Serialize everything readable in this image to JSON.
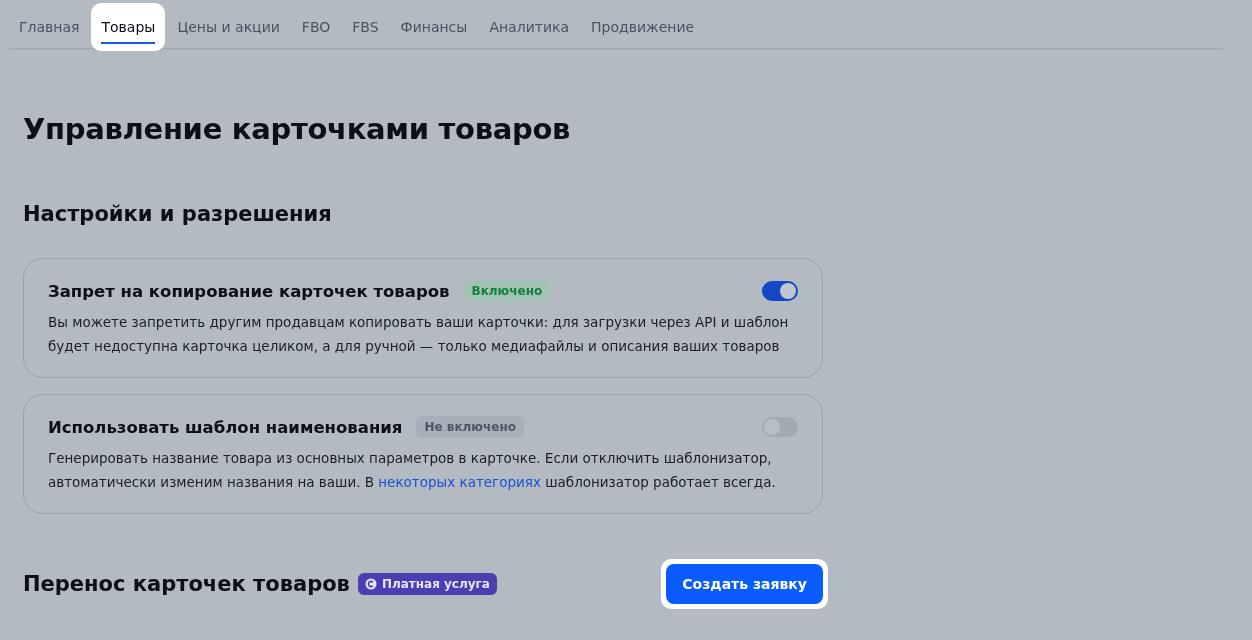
{
  "tabs": [
    {
      "label": "Главная",
      "selected": false
    },
    {
      "label": "Товары",
      "selected": true
    },
    {
      "label": "Цены и акции",
      "selected": false
    },
    {
      "label": "FBO",
      "selected": false
    },
    {
      "label": "FBS",
      "selected": false
    },
    {
      "label": "Финансы",
      "selected": false
    },
    {
      "label": "Аналитика",
      "selected": false
    },
    {
      "label": "Продвижение",
      "selected": false
    }
  ],
  "page_title": "Управление карточками товаров",
  "settings": {
    "heading": "Настройки и разрешения",
    "cards": [
      {
        "title": "Запрет на копирование карточек товаров",
        "status": "Включено",
        "on": true,
        "description": "Вы можете запретить другим продавцам копировать ваши карточки: для загрузки через API и шаблон будет недоступна карточка целиком, а для ручной — только медиафайлы и описания ваших товаров"
      },
      {
        "title": "Использовать шаблон наименования",
        "status": "Не включено",
        "on": false,
        "description": "Генерировать название товара из основных параметров в карточке. Если отключить шаблонизатор, автоматически изменим названия на ваши. В ",
        "link": "некоторых категориях",
        "description_after": " шаблонизатор работает всегда."
      }
    ]
  },
  "transfer": {
    "heading": "Перенос карточек товаров",
    "badge": "Платная услуга",
    "button": "Создать заявку"
  }
}
